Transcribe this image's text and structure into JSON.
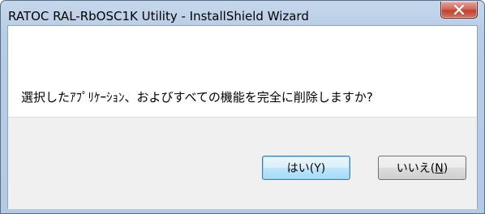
{
  "window": {
    "title": "RATOC RAL-RbOSC1K Utility - InstallShield Wizard",
    "close_glyph": "×"
  },
  "dialog": {
    "message": "選択したｱﾌﾟﾘｹｰｼｮﾝ、およびすべての機能を完全に削除しますか?"
  },
  "buttons": {
    "yes_label": "はい(Y)",
    "no_prefix": "いいえ(",
    "no_mnemonic": "N",
    "no_suffix": ")"
  },
  "colors": {
    "close_button": "#c94a36",
    "default_button_border": "#3c7fb1"
  },
  "icons": {
    "close": "close-icon"
  }
}
